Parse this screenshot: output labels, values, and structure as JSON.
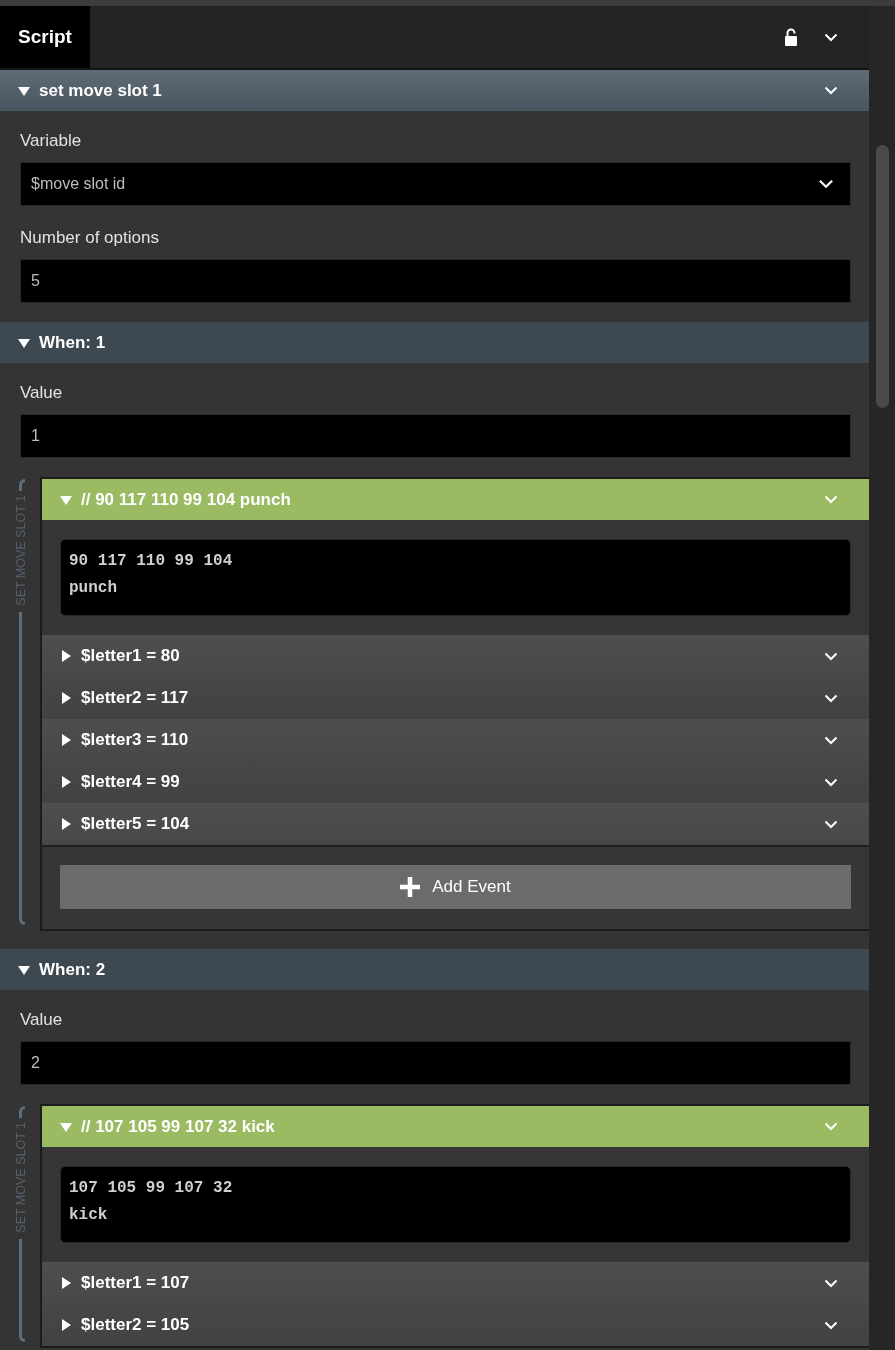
{
  "tab_bar": {
    "tabs": [
      {
        "label": "Script",
        "selected": true
      }
    ],
    "locked": false
  },
  "script": {
    "title": "set move slot 1",
    "expanded": true,
    "fields": [
      {
        "kind": "select",
        "label": "Variable",
        "value": "$move slot id"
      },
      {
        "kind": "text",
        "label": "Number of options",
        "value": "5"
      }
    ],
    "cases": [
      {
        "title": "When: 1",
        "expanded": true,
        "value_label": "Value",
        "value": "1",
        "group_label": "SET MOVE SLOT 1",
        "comment": {
          "title": "// 90 117 110 99 104 punch",
          "expanded": true,
          "code": "90 117 110 99 104\npunch"
        },
        "events": [
          {
            "label": "$letter1 = 80",
            "expanded": false
          },
          {
            "label": "$letter2 = 117",
            "expanded": false
          },
          {
            "label": "$letter3 = 110",
            "expanded": false
          },
          {
            "label": "$letter4 = 99",
            "expanded": false
          },
          {
            "label": "$letter5 = 104",
            "expanded": false
          }
        ],
        "add_button": "Add Event"
      },
      {
        "title": "When: 2",
        "expanded": true,
        "value_label": "Value",
        "value": "2",
        "group_label": "SET MOVE SLOT 1",
        "comment": {
          "title": "// 107 105 99 107 32 kick",
          "expanded": true,
          "code": "107 105 99 107 32\nkick"
        },
        "events": [
          {
            "label": "$letter1 = 107",
            "expanded": false
          },
          {
            "label": "$letter2 = 105",
            "expanded": false
          }
        ]
      }
    ]
  }
}
